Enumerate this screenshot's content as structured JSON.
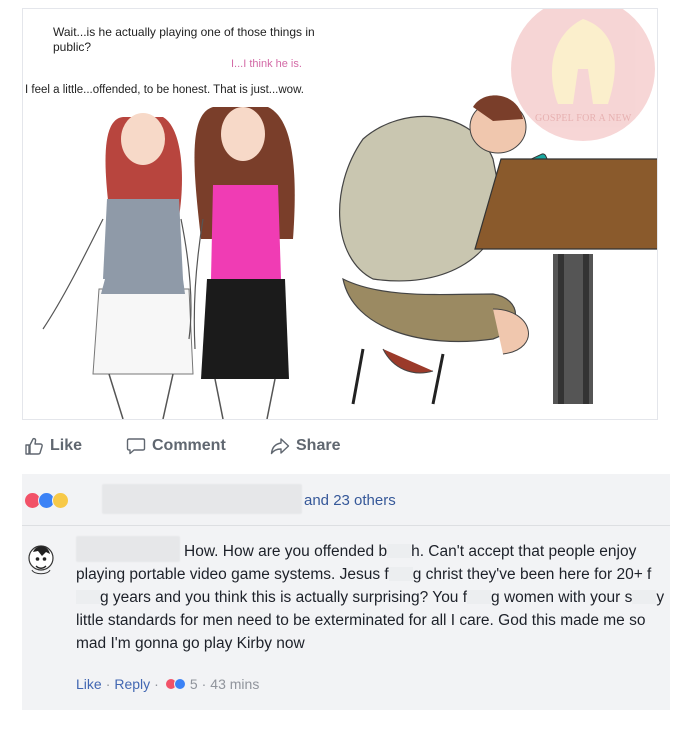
{
  "image": {
    "caption_1": "Wait...is he actually playing one of those things in public?",
    "caption_2": "I...I think he is.",
    "caption_3": "I feel a little...offended, to be honest. That is just...wow.",
    "watermark": "GOSPEL FOR A NEW"
  },
  "actions": {
    "like": "Like",
    "comment": "Comment",
    "share": "Share"
  },
  "reactions": {
    "types": [
      "love-icon",
      "like-icon",
      "haha-icon"
    ],
    "others_text": "and 23 others"
  },
  "comment": {
    "text_parts": [
      "How. How are you offended b",
      "h. Can't accept that people enjoy playing portable video game systems. Jesus f",
      "g christ they've been here for 20+ f",
      "g years and you think this is actually surprising? You f",
      "g women with your s",
      "y little standards for men need to be exterminated for all I care. God this made me so mad I'm gonna go play Kirby now"
    ],
    "meta": {
      "like": "Like",
      "reply": "Reply",
      "reaction_count": "5",
      "time": "43 mins"
    }
  },
  "colors": {
    "link": "#365899",
    "love": "#f25268",
    "like": "#3b82f6",
    "haha": "#f7c948"
  }
}
